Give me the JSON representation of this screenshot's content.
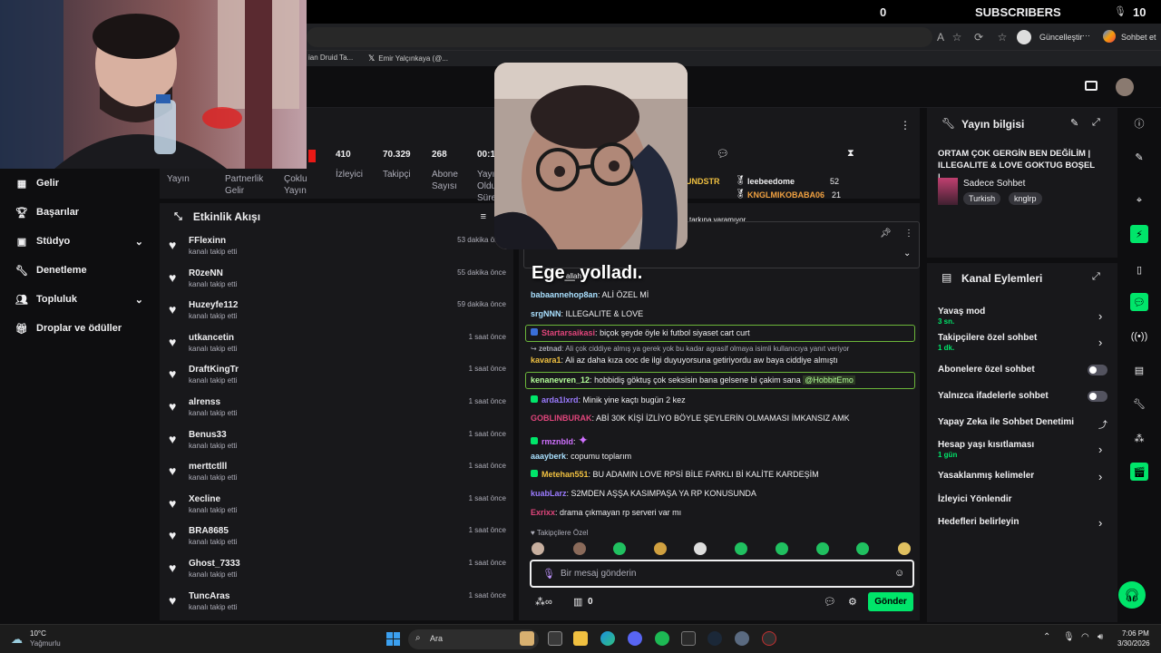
{
  "overlay": {
    "sub_count": "0",
    "subs_label": "SUBSCRIBERS",
    "right_value": "10"
  },
  "browser": {
    "update_label": "Güncelleştir",
    "chat_label": "Sohbet et",
    "tabs": [
      "ian Druid Ta...",
      "Emir Yalçınkaya (@..."
    ]
  },
  "nav": [
    {
      "label": "Gelir",
      "icon": "chart-icon"
    },
    {
      "label": "Başarılar",
      "icon": "trophy-icon"
    },
    {
      "label": "Stüdyo",
      "icon": "studio-icon",
      "chevron": true
    },
    {
      "label": "Denetleme",
      "icon": "wrench-icon"
    },
    {
      "label": "Topluluk",
      "icon": "people-icon",
      "chevron": true
    },
    {
      "label": "Droplar ve ödüller",
      "icon": "gift-icon"
    }
  ],
  "stats": {
    "values": {
      "izleyici": "410",
      "takipci": "70.329",
      "abone": "268",
      "time": "00:1"
    },
    "labels": {
      "yayin": "Yayın",
      "partnerlik": "Partnerlik",
      "gelir": "Gelir",
      "coklu": "Çoklu",
      "yayin2": "Yayın",
      "izleyici": "İzleyici",
      "takipci": "Takipçi",
      "abone": "Abone",
      "sayisi": "Sayısı",
      "yay": "Yayı",
      "oldu": "Oldu",
      "sure": "Süre"
    }
  },
  "activity": {
    "title": "Etkinlik Akışı",
    "items": [
      {
        "name": "FFlexinn",
        "sub": "kanalı takip etti",
        "time": "53 dakika önce"
      },
      {
        "name": "R0zeNN",
        "sub": "kanalı takip etti",
        "time": "55 dakika önce"
      },
      {
        "name": "Huzeyfe112",
        "sub": "kanalı takip etti",
        "time": "59 dakika önce"
      },
      {
        "name": "utkancetin",
        "sub": "kanalı takip etti",
        "time": "1 saat önce"
      },
      {
        "name": "DraftKingTr",
        "sub": "kanalı takip etti",
        "time": "1 saat önce"
      },
      {
        "name": "alrenss",
        "sub": "kanalı takip etti",
        "time": "1 saat önce"
      },
      {
        "name": "Benus33",
        "sub": "kanalı takip etti",
        "time": "1 saat önce"
      },
      {
        "name": "merttctlll",
        "sub": "kanalı takip etti",
        "time": "1 saat önce"
      },
      {
        "name": "Xecline",
        "sub": "kanalı takip etti",
        "time": "1 saat önce"
      },
      {
        "name": "BRA8685",
        "sub": "kanalı takip etti",
        "time": "1 saat önce"
      },
      {
        "name": "Ghost_7333",
        "sub": "kanalı takip etti",
        "time": "1 saat önce"
      },
      {
        "name": "TuncAras",
        "sub": "kanalı takip etti",
        "time": "1 saat önce"
      }
    ]
  },
  "chat_top": {
    "leaders": [
      {
        "name": "leebeedome",
        "count": "52"
      },
      {
        "name": "KNGLMIKOBABA06",
        "count": "21"
      }
    ],
    "partial": "UNDSTR",
    "pinned_partial": "tarkına varamıyor"
  },
  "chat": {
    "alert": "Ege_ yolladı.",
    "alert_partial": "allah",
    "messages": [
      {
        "user": "babaannehop8an",
        "color": "#a9e0ff",
        "text": "ALİ ÖZEL Mİ"
      },
      {
        "user": "srgNNN",
        "color": "#a9e0ff",
        "text": "ILLEGALITE & LOVE"
      },
      {
        "user": "Startarsaikasi",
        "color": "#e0457b",
        "text": "biçok şeyde öyle ki futbol siyaset cart curt"
      },
      {
        "user": "zetnad",
        "color": "#adadb8",
        "text": "Ali çok ciddiye almış ya gerek yok bu kadar agrasif olmaya isimli kullanıcıya yanıt veriyor"
      },
      {
        "user": "kavara1",
        "color": "#f0c040",
        "text": "Ali az daha kıza ooc de ilgi duyuyorsuna getiriyordu aw baya ciddiye almıştı"
      },
      {
        "user": "kenanevren_12",
        "color": "#b4ff9a",
        "text": "hobbidiş göktuş çok seksisin bana gelsene bi çakim sana",
        "mention": "@HobbitEmo"
      },
      {
        "user": "arda1lxrd",
        "color": "#9b7bff",
        "text": "Minik yine kaçtı bugün 2 kez"
      },
      {
        "user": "GOBLINBURAK",
        "color": "#e0457b",
        "text": "ABİ 30K KİŞİ İZLİYO BÖYLE ŞEYLERİN OLMAMASI İMKANSIZ AMK"
      },
      {
        "user": "rmznbld",
        "color": "#d070ff",
        "text": ""
      },
      {
        "user": "aaayberk",
        "color": "#a9e0ff",
        "text": "copumu toplarım"
      },
      {
        "user": "Metehan551",
        "color": "#f0c040",
        "text": "BU ADAMIN LOVE RPSİ BİLE FARKLI Bİ KALİTE KARDEŞİM"
      },
      {
        "user": "kuabLarz",
        "color": "#9b7bff",
        "text": "S2MDEN AŞŞA KASIMPAŞA YA RP KONUSUNDA"
      },
      {
        "user": "Exrixx",
        "color": "#e0457b",
        "text": "drama çıkmayan rp serveri var mı"
      }
    ],
    "follower_only": "Takipçilere Özel",
    "input_placeholder": "Bir mesaj gönderin",
    "points": "0",
    "send_label": "Gönder"
  },
  "info": {
    "title": "Yayın bilgisi",
    "stream_title": "ORTAM ÇOK GERGİN BEN DEĞİLİM | ILLEGALITE & LOVE GOKTUG BOŞEL |...",
    "category": "Sadece Sohbet",
    "tags": [
      "Turkish",
      "knglrp"
    ]
  },
  "actions": {
    "title": "Kanal Eylemleri",
    "items": [
      {
        "label": "Yavaş mod",
        "sub": "3 sn.",
        "control": "chevron"
      },
      {
        "label": "Takipçilere özel sohbet",
        "sub": "1 dk.",
        "control": "chevron"
      },
      {
        "label": "Abonelere özel sohbet",
        "sub": "",
        "control": "toggle"
      },
      {
        "label": "Yalnızca ifadelerle sohbet",
        "sub": "",
        "control": "toggle"
      },
      {
        "label": "Yapay Zeka ile Sohbet Denetimi",
        "sub": "",
        "control": "external"
      },
      {
        "label": "Hesap yaşı kısıtlaması",
        "sub": "1 gün",
        "control": "chevron"
      },
      {
        "label": "Yasaklanmış kelimeler",
        "sub": "",
        "control": "chevron"
      },
      {
        "label": "İzleyici Yönlendir",
        "sub": "",
        "control": "none"
      },
      {
        "label": "Hedefleri belirleyin",
        "sub": "",
        "control": "chevron"
      }
    ]
  },
  "taskbar": {
    "temp": "10°C",
    "weather": "Yağmurlu",
    "search": "Ara",
    "time": "7:06 PM",
    "date": "3/30/2026"
  },
  "colors": {
    "accent": "#00e56a",
    "panel": "#18181b",
    "bg": "#0e0e10"
  }
}
